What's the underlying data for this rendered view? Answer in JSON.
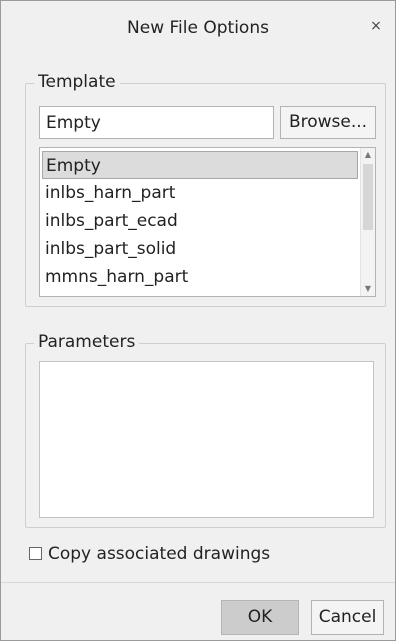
{
  "dialog": {
    "title": "New File Options",
    "close_glyph": "×"
  },
  "template": {
    "legend": "Template",
    "input_value": "Empty",
    "browse_label": "Browse...",
    "items": [
      {
        "label": "Empty",
        "selected": true
      },
      {
        "label": "inlbs_harn_part",
        "selected": false
      },
      {
        "label": "inlbs_part_ecad",
        "selected": false
      },
      {
        "label": "inlbs_part_solid",
        "selected": false
      },
      {
        "label": "mmns_harn_part",
        "selected": false
      }
    ],
    "scroll_up_glyph": "▲",
    "scroll_down_glyph": "▼"
  },
  "parameters": {
    "legend": "Parameters"
  },
  "copy_drawings": {
    "label": "Copy associated drawings",
    "checked": false
  },
  "buttons": {
    "ok": "OK",
    "cancel": "Cancel"
  }
}
